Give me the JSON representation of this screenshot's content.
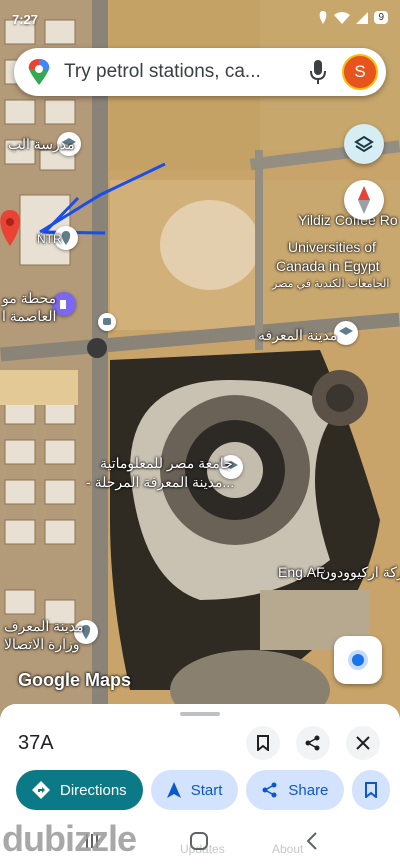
{
  "status_bar": {
    "time": "7:27",
    "battery": "9"
  },
  "search": {
    "placeholder": "Try petrol stations, ca...",
    "avatar_letter": "S"
  },
  "map_labels": {
    "school": "مدرسة الب",
    "yildiz": "Yildiz Coffee Ro",
    "universities": "Universities of",
    "canada": "Canada in Egypt",
    "canada_ar": "الجامعات الكندية في مصر",
    "maarefa": "مدينة المعرفه",
    "nile_u1": "جامعة مصر للمعلوماتية",
    "nile_u2": "- مدينة المعرفة المرحلة...",
    "engaf": "Eng.AF",
    "engaf_ar": "ركة اركيوودون",
    "station1": "محطة مو",
    "station2": "العاصمة ا",
    "ministry1": "مدينة المعرف",
    "ministry2": "وزارة الاتصالا",
    "ntr": "NTR"
  },
  "logo": "Google Maps",
  "place": {
    "title": "37A",
    "actions": {
      "directions": "Directions",
      "start": "Start",
      "share": "Share"
    }
  },
  "system_nav": {
    "updates": "Updates",
    "about": "About"
  },
  "watermark": "dubizzle",
  "icons": [
    "search-pin-icon",
    "mic-icon",
    "layers-icon",
    "compass-icon",
    "my-location-icon",
    "bookmark-icon",
    "share-icon",
    "close-icon",
    "directions-icon",
    "navigation-icon"
  ],
  "colors": {
    "accent": "#0b7a86",
    "chip": "#d3e3fd",
    "pin": "#ea4335"
  }
}
